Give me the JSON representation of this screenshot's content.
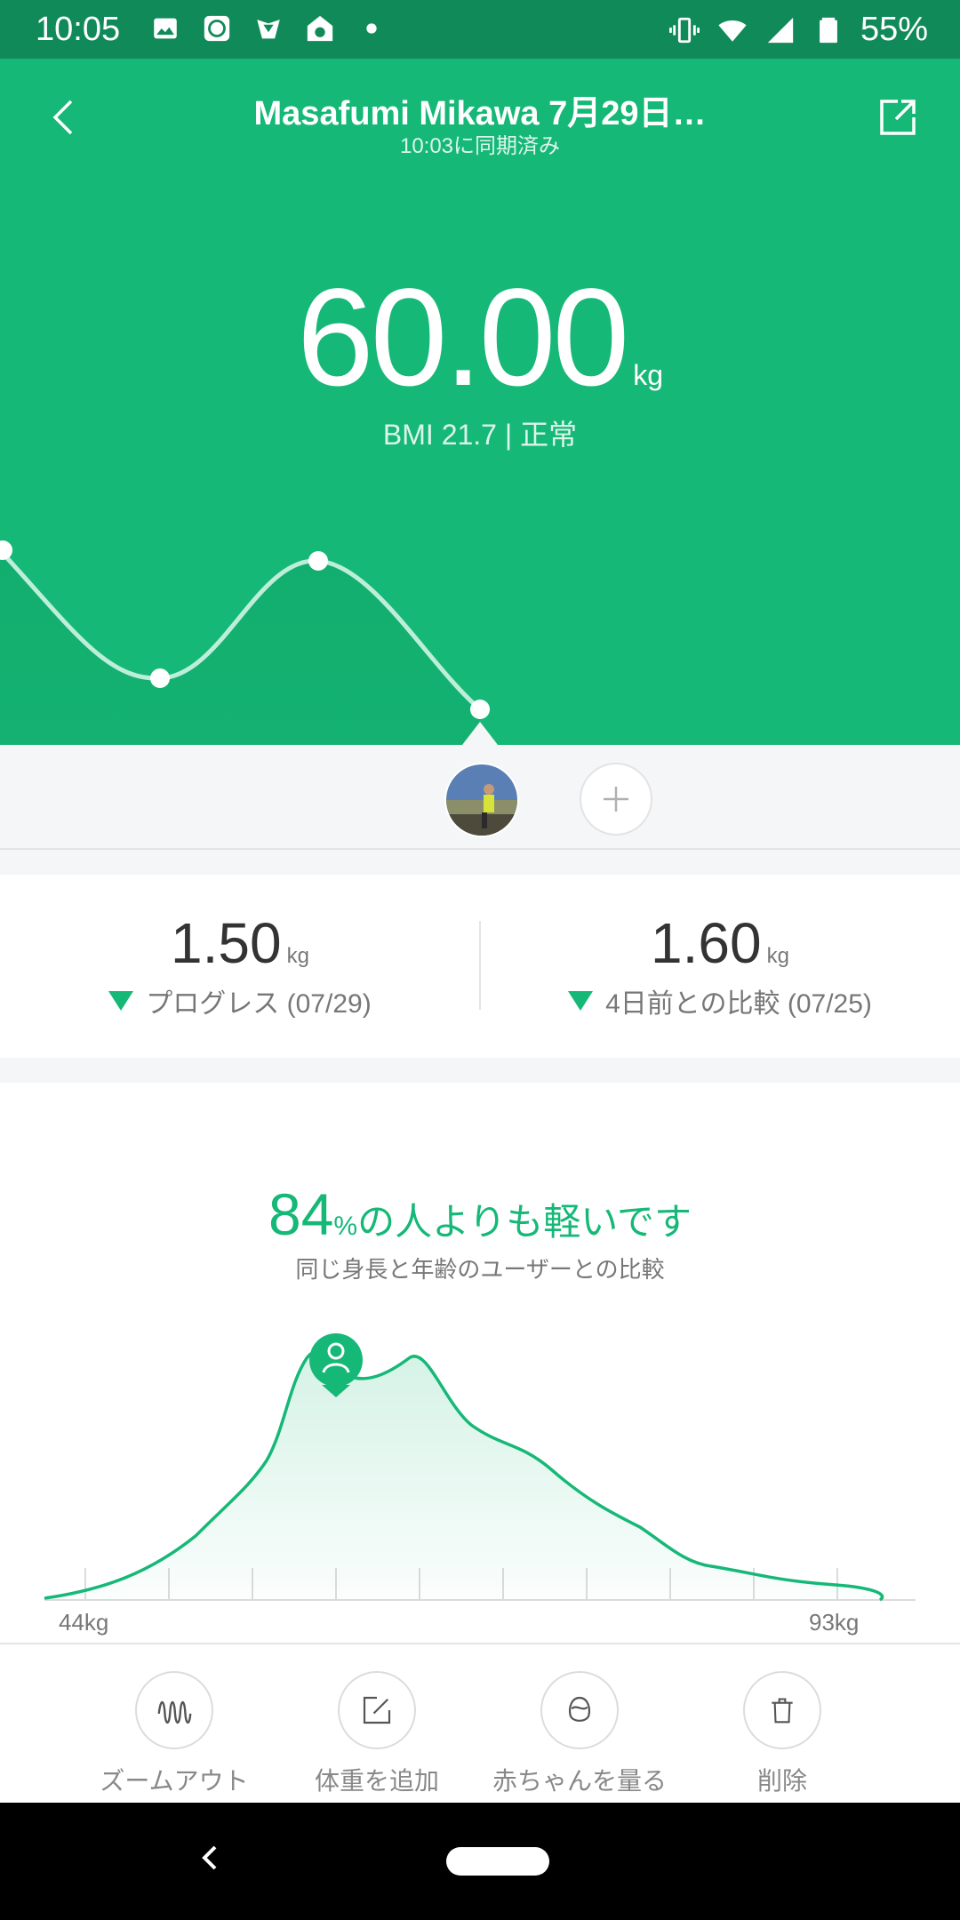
{
  "status_bar": {
    "time": "10:05",
    "battery": "55%",
    "icons_left": [
      "image-icon",
      "mi-fit-icon",
      "shield-app-icon",
      "soccer-icon",
      "dot-icon"
    ],
    "icons_right": [
      "vibrate-icon",
      "wifi-icon",
      "signal-icon",
      "battery-icon"
    ]
  },
  "header": {
    "title": "Masafumi Mikawa 7月29日…",
    "subtitle": "10:03に同期済み"
  },
  "hero": {
    "weight": "60.00",
    "unit": "kg",
    "bmi": "BMI 21.7 | 正常"
  },
  "trend": {
    "series": [
      60.2,
      59.5,
      60.1,
      59.3
    ]
  },
  "stats": [
    {
      "value": "1.50",
      "unit": "kg",
      "label": "プログレス (07/29)"
    },
    {
      "value": "1.60",
      "unit": "kg",
      "label": "4日前との比較 (07/25)"
    }
  ],
  "comparison": {
    "percent": "84",
    "percent_sign": "%",
    "title_rest": "の人よりも軽いです",
    "subtitle": "同じ身長と年齢のユーザーとの比較",
    "axis_min": "44kg",
    "axis_max": "93kg"
  },
  "actions": [
    {
      "label": "ズームアウト",
      "icon": "zoom-out-wave-icon"
    },
    {
      "label": "体重を追加",
      "icon": "edit-icon"
    },
    {
      "label": "赤ちゃんを量る",
      "icon": "baby-icon"
    },
    {
      "label": "削除",
      "icon": "trash-icon"
    }
  ],
  "colors": {
    "accent": "#16b877",
    "status_bar": "#118a59"
  }
}
